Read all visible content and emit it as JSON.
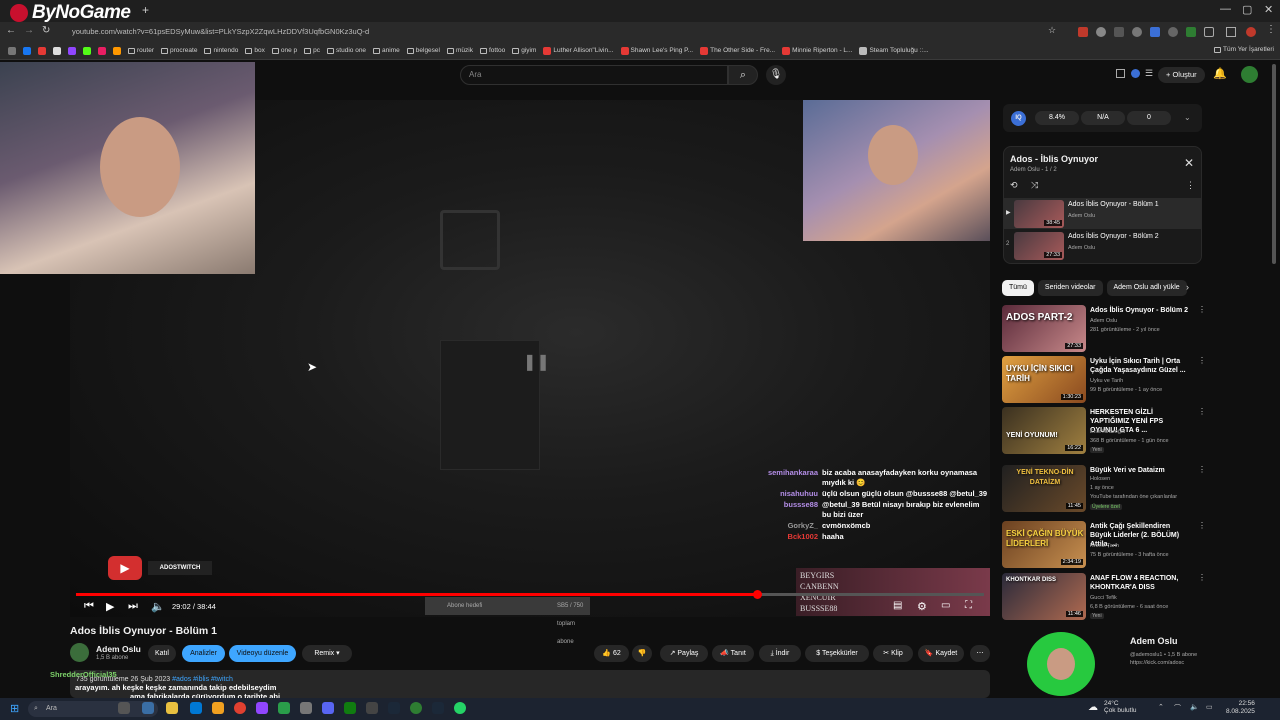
{
  "browser": {
    "logo_text": "ByNoGame",
    "new_tab": "+",
    "url": "youtube.com/watch?v=61psEDSyMuw&list=PLkYSzpX2ZqwLHzDDVf3UqfbGN0Kz3uQ-d",
    "bookmarks": [
      "router",
      "procreate",
      "nintendo",
      "box",
      "one p",
      "pc",
      "studio one",
      "anime",
      "belgesel",
      "müzik",
      "fottoo",
      "giyim",
      "Luther Allison\"Livin...",
      "Shawn Lee's Ping P...",
      "The Other Side - Fre...",
      "Minnie Riperton - L...",
      "Steam Topluluğu ::..."
    ],
    "all_bookmarks": "Tüm Yer İşaretleri"
  },
  "header": {
    "search_placeholder": "Ara",
    "create_label": "+ Oluştur"
  },
  "video": {
    "title": "Ados İblis Oynuyor - Bölüm 1",
    "time": "29:02 / 38:44",
    "progress": 0.75,
    "sub_overlay": "SB5 / 750 toplam abone",
    "sub_goal": "Abone hedefi",
    "badge_label": "ADOSTWITCH",
    "names_overlay": [
      "BEYGIRS",
      "CANBENN",
      "XENCUIR",
      "BUSSSE88"
    ],
    "chat": [
      {
        "user": "semihankaraa",
        "text": "biz acaba anasayfadayken korku oynamasa mıydık ki 😊"
      },
      {
        "user": "nisahuhuu",
        "text": "üçlü olsun güçlü olsun @bussse88 @betul_39"
      },
      {
        "user": "bussse88",
        "text": "@betul_39 Betül nisayı bırakıp biz evlenelim bu bizi üzer"
      },
      {
        "user": "GorkyZ_",
        "text": "cvmönxömcb"
      },
      {
        "user": "Bck1002",
        "text": "haaha"
      }
    ]
  },
  "channel": {
    "name": "Adem Oslu",
    "subs": "1,5 B abone",
    "join": "Katıl",
    "analytics": "Analizler",
    "edit": "Videoyu düzenle",
    "remix": "Remix"
  },
  "actions": {
    "likes": "62",
    "share": "Paylaş",
    "promote": "Tanıt",
    "download": "İndir",
    "thanks": "Teşekkürler",
    "clip": "Klip",
    "save": "Kaydet"
  },
  "description": {
    "meta": "735 görüntüleme  26 Şub 2023",
    "tags": "#ados #iblis #twitch",
    "overlay_user": "ShredderOfficial35",
    "overlay_text1": "arayayım. ah keşke keşke zamanında takip edebilseydim",
    "overlay_text2": "ama fabrikalarda çürüyordum o tarihte abi"
  },
  "sidebar": {
    "iq_label": "IQ",
    "iq_values": [
      "8.4%",
      "N/A",
      "0"
    ],
    "playlist_title": "Ados - İblis Oynuyor",
    "playlist_sub": "Adem Oslu - 1 / 2",
    "playlist_items": [
      {
        "title": "Ados İblis Oynuyor - Bölüm 1",
        "channel": "Adem Oslu",
        "duration": "38:45"
      },
      {
        "title": "Ados İblis Oynuyor - Bölüm 2",
        "channel": "Adem Oslu",
        "duration": "27:33"
      }
    ],
    "chips": [
      "Tümü",
      "Seriden videolar",
      "Adem Oslu adlı yükle"
    ],
    "recommendations": [
      {
        "title": "Ados İblis Oynuyor - Bölüm 2",
        "channel": "Adem Oslu",
        "meta": "281 görüntüleme - 2 yıl önce",
        "duration": "27:33",
        "thumb_text": "ADOS PART-2",
        "badge": ""
      },
      {
        "title": "Uyku İçin Sıkıcı Tarih | Orta Çağda Yaşasaydınız Güzel ...",
        "channel": "Uyku ve Tarih",
        "meta": "99 B görüntüleme - 1 ay önce",
        "duration": "1:30:23",
        "thumb_text": "UYKU İÇİN SIKICI TARİH",
        "badge": ""
      },
      {
        "title": "HERKESTEN GİZLİ YAPTIĞIMIZ YENİ FPS OYUNU! GTA 6 ...",
        "channel": "Enis Kirazoğlu",
        "meta": "368 B görüntüleme - 1 gün önce",
        "duration": "16:22",
        "thumb_text": "YENİ OYUNUM!",
        "badge": "Yeni"
      },
      {
        "title": "Büyük Veri ve Dataizm",
        "channel": "Holosen",
        "meta": "1 ay önce",
        "duration": "11:45",
        "thumb_text": "YENİ TEKNO-DİN DATAİZM",
        "badge": "Üyelere özel",
        "extra": "YouTube tarafından öne çıkarılanlar"
      },
      {
        "title": "Antik Çağı Şekillendiren Büyük Liderler (2. BÖLÜM) Attila, ...",
        "channel": "Kronik Tarih",
        "meta": "75 B görüntüleme - 3 hafta önce",
        "duration": "2:34:19",
        "thumb_text": "ESKİ ÇAĞIN BÜYÜK LİDERLERİ",
        "badge": ""
      },
      {
        "title": "ANAF FLOW 4 REACTION, KHONTKAR'A DISS",
        "channel": "Gucci Tefik",
        "meta": "6,8 B görüntüleme - 6 saat önce",
        "duration": "11:46",
        "thumb_text": "KHONTKAR DISS",
        "badge": "Yeni"
      }
    ],
    "card_name": "Adem Oslu",
    "card_info": "@ademoslu1 • 1,5 B abone",
    "card_link": "https://kick.com/adosc"
  },
  "taskbar": {
    "search": "Ara",
    "weather_temp": "24°C",
    "weather_desc": "Çok bulutlu",
    "time": "22:56",
    "date": "8.08.2025"
  }
}
